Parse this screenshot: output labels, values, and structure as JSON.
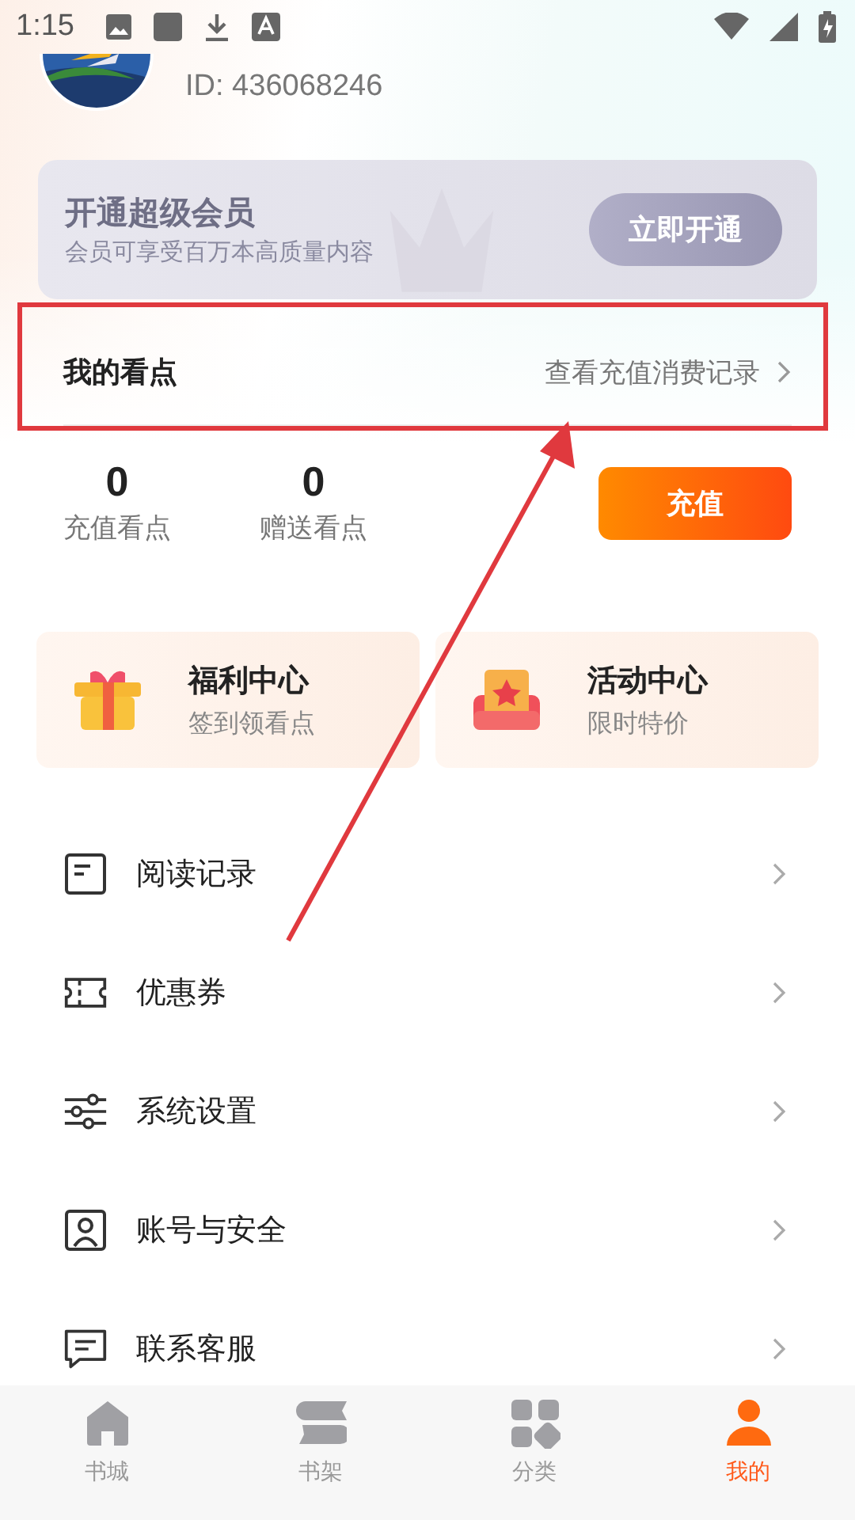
{
  "status_bar": {
    "time": "1:15"
  },
  "profile": {
    "id": "ID: 436068246"
  },
  "vip": {
    "title": "开通超级会员",
    "subtitle": "会员可享受百万本高质量内容",
    "button": "立即开通"
  },
  "points": {
    "title": "我的看点",
    "link": "查看充值消费记录"
  },
  "stats": [
    {
      "value": "0",
      "label": "充值看点"
    },
    {
      "value": "0",
      "label": "赠送看点"
    }
  ],
  "recharge_button": "充值",
  "promos": [
    {
      "kind": "gift",
      "title": "福利中心",
      "subtitle": "签到领看点"
    },
    {
      "kind": "event",
      "title": "活动中心",
      "subtitle": "限时特价"
    }
  ],
  "menu": [
    {
      "kind": "history",
      "label": "阅读记录"
    },
    {
      "kind": "coupon",
      "label": "优惠券"
    },
    {
      "kind": "settings",
      "label": "系统设置"
    },
    {
      "kind": "account",
      "label": "账号与安全"
    },
    {
      "kind": "service",
      "label": "联系客服"
    }
  ],
  "tab_bar": [
    {
      "kind": "home",
      "label": "书城",
      "selected": false
    },
    {
      "kind": "shelf",
      "label": "书架",
      "selected": false
    },
    {
      "kind": "category",
      "label": "分类",
      "selected": false
    },
    {
      "kind": "me",
      "label": "我的",
      "selected": true
    }
  ]
}
